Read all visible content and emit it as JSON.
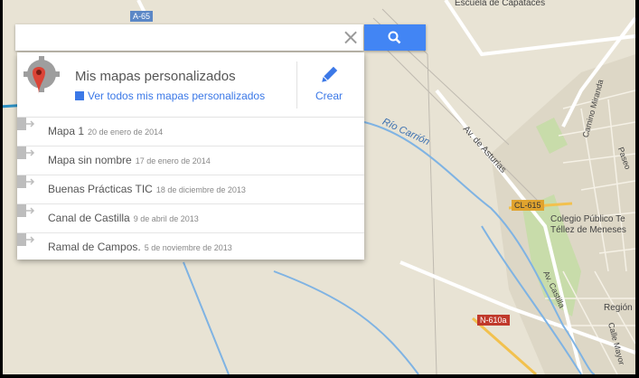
{
  "search": {
    "value": "",
    "clear_symbol": "×"
  },
  "panel": {
    "title": "Mis mapas personalizados",
    "view_all_label": "Ver todos mis mapas personalizados",
    "create_label": "Crear",
    "maps": [
      {
        "name": "Mapa 1",
        "date": "20 de enero de 2014"
      },
      {
        "name": "Mapa sin nombre",
        "date": "17 de enero de 2014"
      },
      {
        "name": "Buenas Prácticas TIC",
        "date": "18 de diciembre de 2013"
      },
      {
        "name": "Canal de Castilla",
        "date": "9 de abril de 2013"
      },
      {
        "name": "Ramal de Campos.",
        "date": "5 de noviembre de 2013"
      }
    ]
  },
  "map": {
    "road_a65": "A-65",
    "road_cl615": "CL-615",
    "road_n610a": "N-610a",
    "river_label": "Río Carrión",
    "street_asturias": "Av. de Asturias",
    "street_miranda": "Camino Miranda",
    "street_paseo": "Paseo",
    "street_castilla": "Av. Castilla",
    "street_mayor": "Calle Mayor",
    "poi_school_line1": "Colegio Público Te",
    "poi_school_line2": "Téllez de Meneses",
    "poi_region": "Región",
    "top_label": "Escuela de Capataces"
  },
  "colors": {
    "accent_blue": "#4285f4",
    "link_blue": "#3b78e7",
    "annotation_arrow": "#2b8fc2",
    "map_bg": "#e8e3d4",
    "river": "#7fb3e3",
    "park": "#c8dcaa"
  },
  "icons": {
    "clear": "close-icon",
    "search": "search-icon",
    "logo": "my-maps-logo-icon",
    "create": "pencil-icon",
    "row": "map-link-icon"
  }
}
